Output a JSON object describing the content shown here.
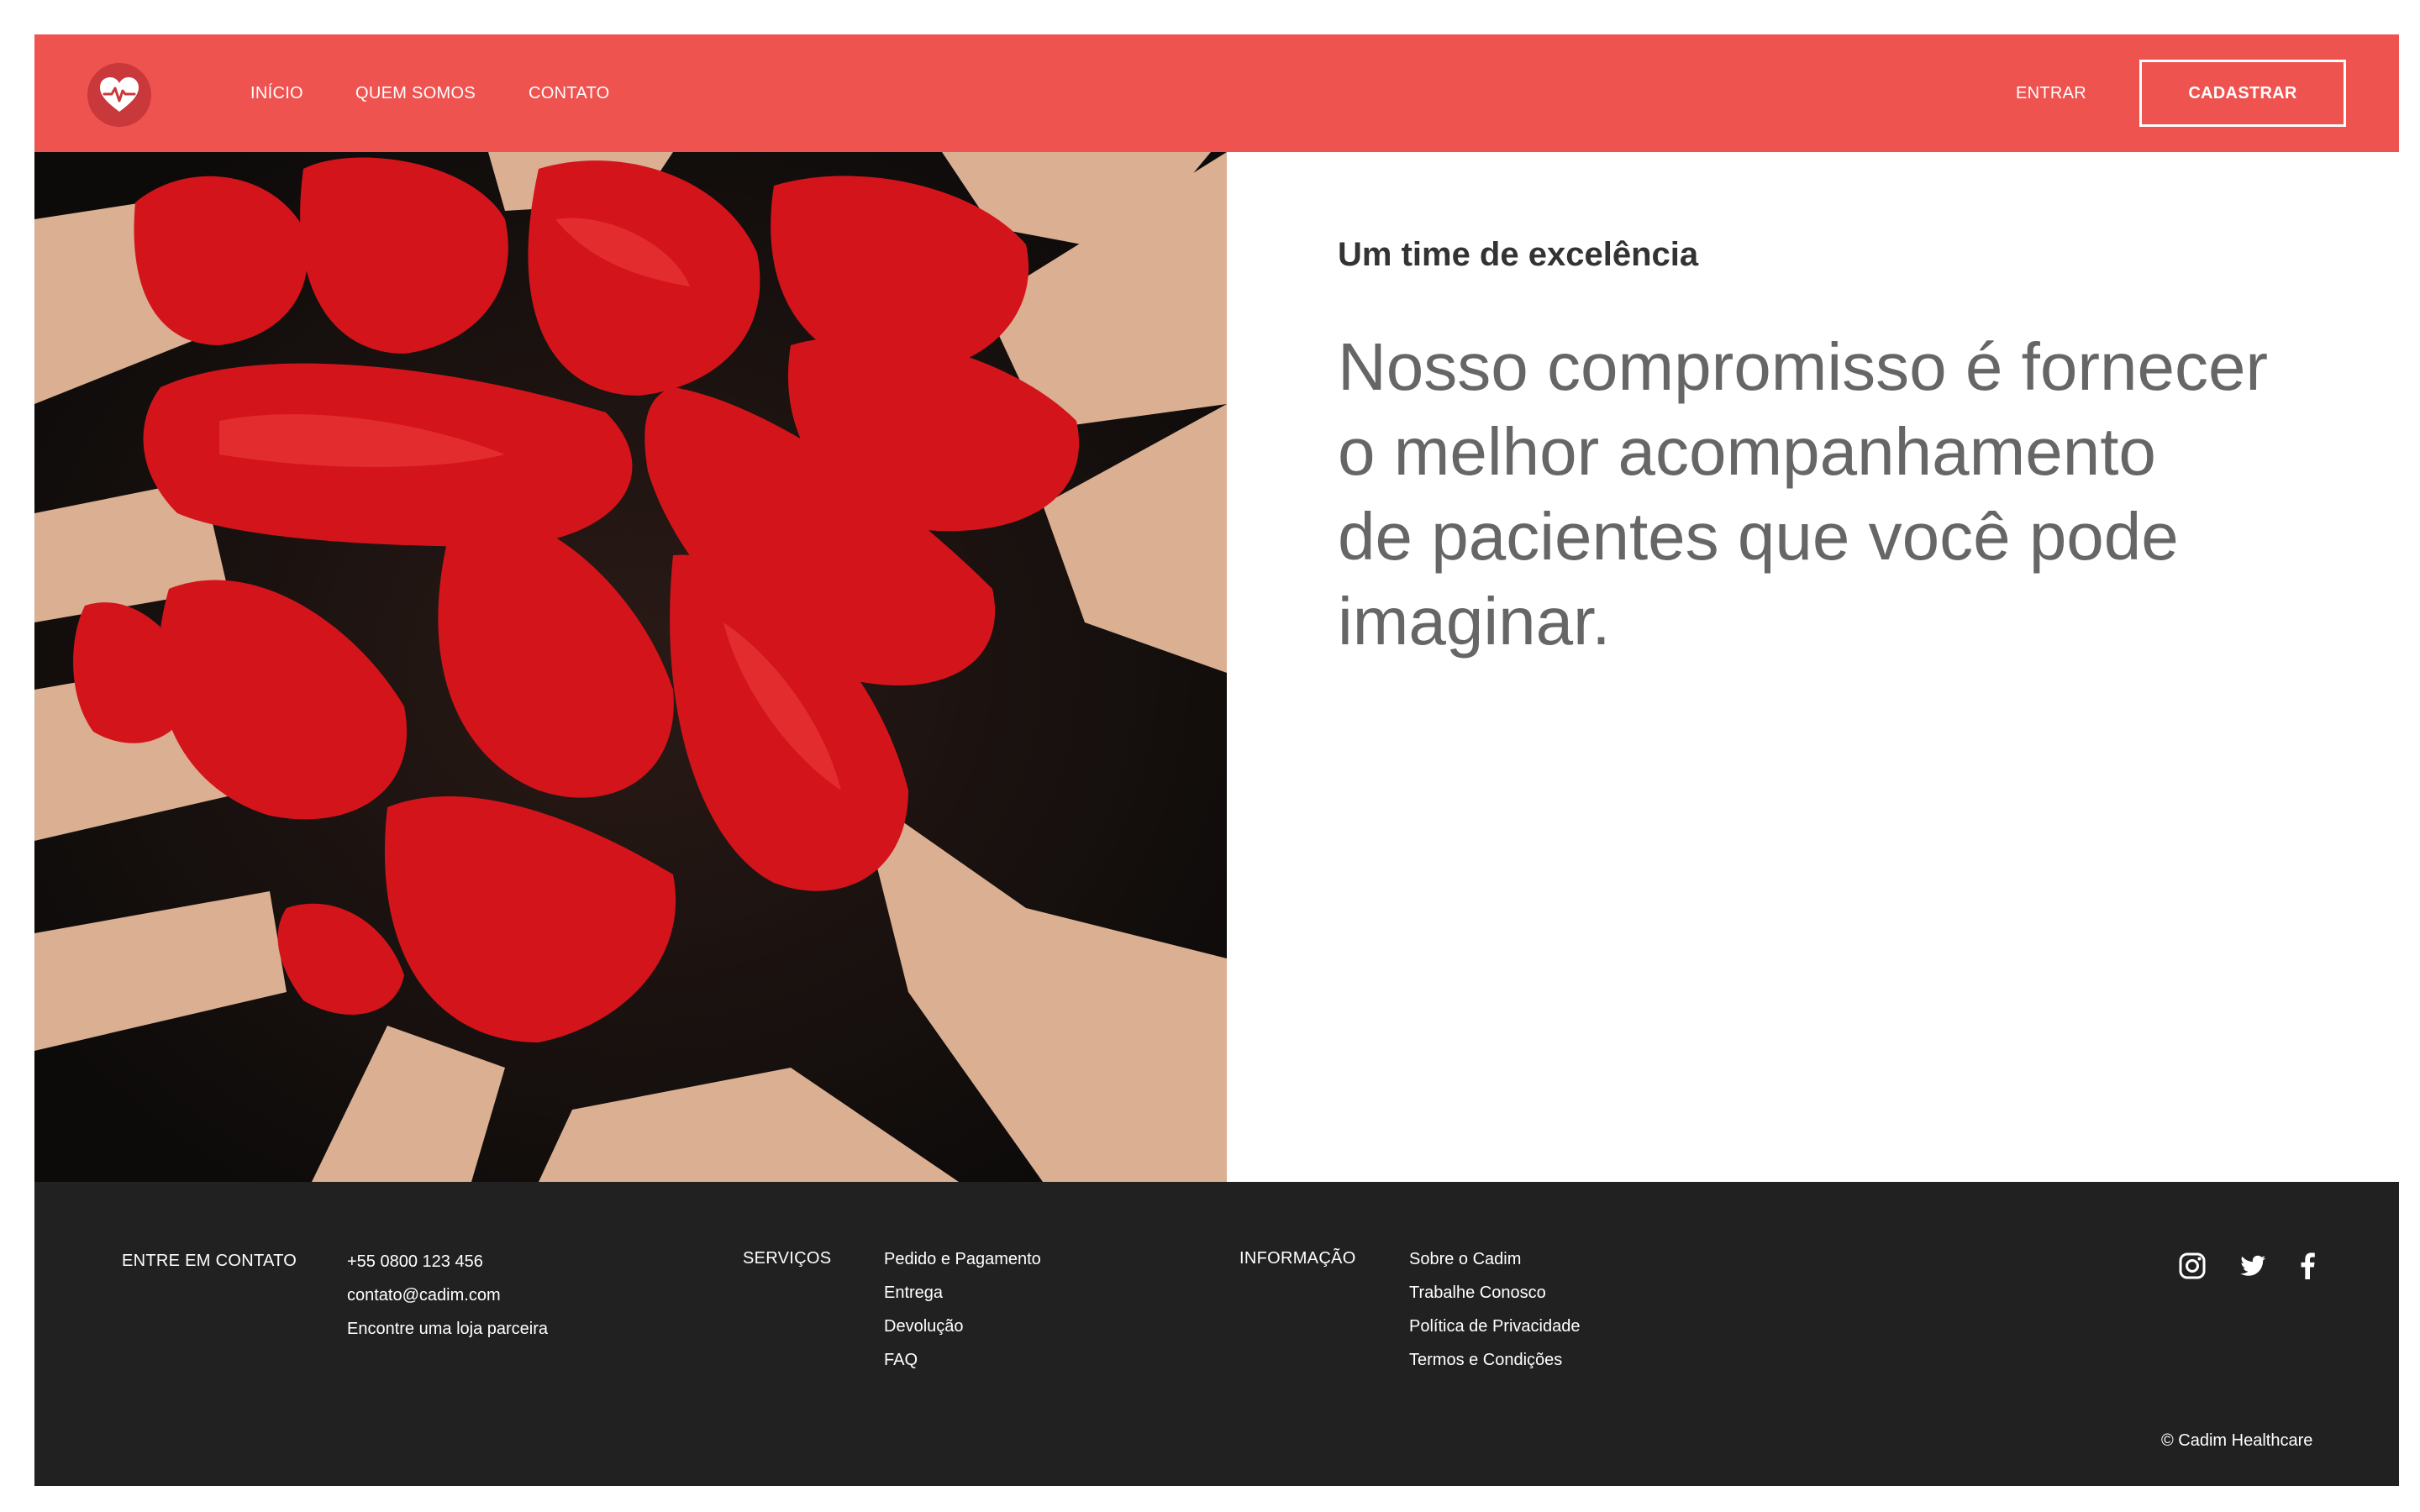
{
  "brand": {
    "logo_icon": "heart-pulse-icon",
    "accent_color": "#ef5350",
    "logo_bg": "#c9383a"
  },
  "nav": {
    "items": [
      {
        "label": "INÍCIO"
      },
      {
        "label": "QUEM SOMOS"
      },
      {
        "label": "CONTATO"
      }
    ],
    "login_label": "ENTRAR",
    "signup_label": "CADASTRAR"
  },
  "hero": {
    "image_alt": "hands-painted-red-heart",
    "eyebrow": "Um time de excelência",
    "headline_lines": [
      "Nosso compromisso é fornecer",
      "o melhor acompanhamento",
      "de pacientes que você pode",
      "imaginar."
    ]
  },
  "footer": {
    "bg_color": "#212121",
    "contact": {
      "title": "ENTRE EM CONTATO",
      "items": [
        "+55 0800 123 456",
        "contato@cadim.com",
        "Encontre uma loja parceira"
      ]
    },
    "services": {
      "title": "SERVIÇOS",
      "items": [
        "Pedido e Pagamento",
        "Entrega",
        "Devolução",
        "FAQ"
      ]
    },
    "info": {
      "title": "INFORMAÇÃO",
      "items": [
        "Sobre o Cadim",
        "Trabalhe Conosco",
        "Política de Privacidade",
        "Termos e Condições"
      ]
    },
    "social": [
      "instagram-icon",
      "twitter-icon",
      "facebook-icon"
    ],
    "copyright": "© Cadim Healthcare"
  }
}
